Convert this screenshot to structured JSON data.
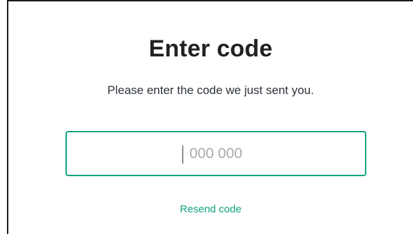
{
  "header": {
    "title": "Enter code",
    "subtitle": "Please enter the code we just sent you."
  },
  "code_input": {
    "value": "",
    "placeholder": "000 000"
  },
  "actions": {
    "resend_label": "Resend code"
  },
  "colors": {
    "accent": "#10a37f",
    "title_text": "#202123",
    "body_text": "#2d333a",
    "placeholder_text": "#a7a9ad"
  }
}
